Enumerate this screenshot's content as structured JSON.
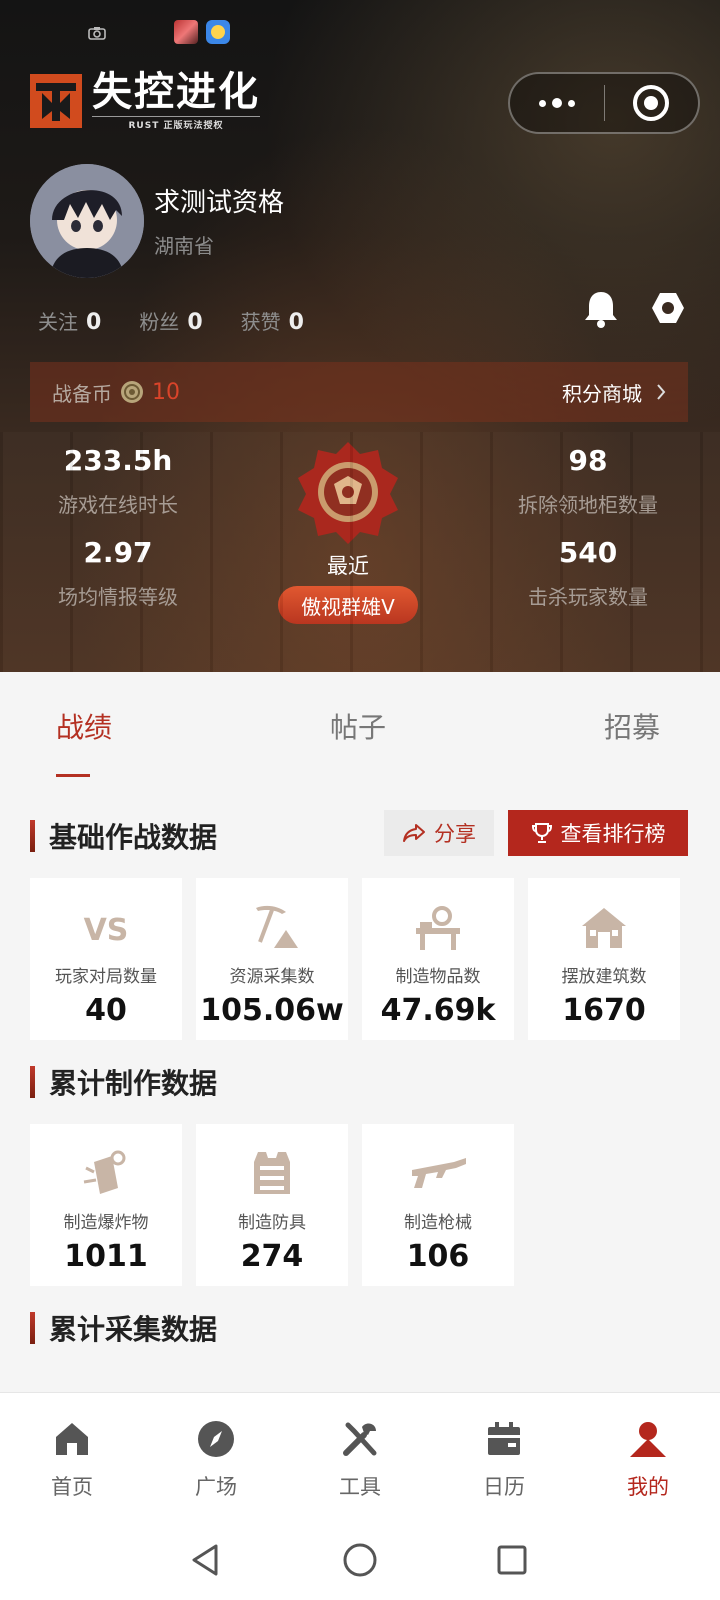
{
  "header": {
    "logo_text": "失控进化",
    "logo_subtitle": "RUST 正版玩法授权",
    "capsule": {
      "more_icon": "more-dots-icon",
      "close_icon": "record-circle-icon"
    }
  },
  "profile": {
    "username": "求测试资格",
    "region": "湖南省",
    "stats": [
      {
        "label": "关注",
        "value": "0"
      },
      {
        "label": "粉丝",
        "value": "0"
      },
      {
        "label": "获赞",
        "value": "0"
      }
    ]
  },
  "coin_bar": {
    "label": "战备币",
    "value": "10",
    "shop_label": "积分商城"
  },
  "metrics": {
    "online_hours": {
      "value": "233.5h",
      "label": "游戏在线时长"
    },
    "intel_level": {
      "value": "2.97",
      "label": "场均情报等级"
    },
    "cabinets_destroyed": {
      "value": "98",
      "label": "拆除领地柜数量"
    },
    "players_killed": {
      "value": "540",
      "label": "击杀玩家数量"
    },
    "medal": {
      "caption": "最近",
      "rank": "傲视群雄V"
    }
  },
  "tabs": [
    {
      "label": "战绩",
      "active": true
    },
    {
      "label": "帖子",
      "active": false
    },
    {
      "label": "招募",
      "active": false
    }
  ],
  "sections": {
    "basic": {
      "title": "基础作战数据",
      "share_label": "分享",
      "leaderboard_label": "查看排行榜",
      "cards": [
        {
          "icon": "vs-icon",
          "label": "玩家对局数量",
          "value": "40"
        },
        {
          "icon": "pickaxe-icon",
          "label": "资源采集数",
          "value": "105.06w"
        },
        {
          "icon": "workbench-icon",
          "label": "制造物品数",
          "value": "47.69k"
        },
        {
          "icon": "house-icon",
          "label": "摆放建筑数",
          "value": "1670"
        }
      ]
    },
    "crafting": {
      "title": "累计制作数据",
      "cards": [
        {
          "icon": "explosive-icon",
          "label": "制造爆炸物",
          "value": "1011"
        },
        {
          "icon": "armor-icon",
          "label": "制造防具",
          "value": "274"
        },
        {
          "icon": "rifle-icon",
          "label": "制造枪械",
          "value": "106"
        }
      ]
    },
    "gathering": {
      "title": "累计采集数据"
    }
  },
  "bottom_nav": [
    {
      "label": "首页",
      "icon": "home-icon",
      "active": false
    },
    {
      "label": "广场",
      "icon": "compass-icon",
      "active": false
    },
    {
      "label": "工具",
      "icon": "tools-icon",
      "active": false
    },
    {
      "label": "日历",
      "icon": "calendar-icon",
      "active": false
    },
    {
      "label": "我的",
      "icon": "user-icon",
      "active": true
    }
  ],
  "colors": {
    "accent": "#b4271d",
    "coin_value": "#d9442a",
    "nav_inactive": "#666666"
  }
}
